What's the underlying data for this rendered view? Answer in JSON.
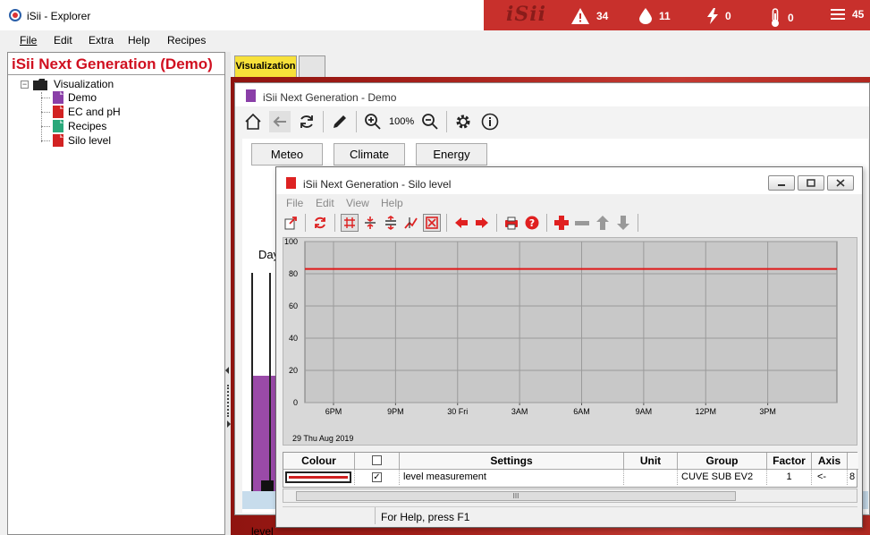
{
  "app": {
    "title": "iSii - Explorer"
  },
  "status_bar": {
    "logo": "iSii",
    "items": [
      {
        "icon": "warning-icon",
        "value": "34"
      },
      {
        "icon": "drop-icon",
        "value": "11"
      },
      {
        "icon": "lightning-icon",
        "value": "0"
      },
      {
        "icon": "thermometer-icon",
        "value": "0"
      },
      {
        "icon": "list-icon",
        "value": "45"
      }
    ],
    "color": "#c8302c"
  },
  "menu": {
    "file": "File",
    "edit": "Edit",
    "extra": "Extra",
    "help": "Help",
    "recipes": "Recipes"
  },
  "explorer": {
    "brand": "iSii Next Generation (Demo)",
    "root": "Visualization",
    "items": [
      {
        "label": "Demo",
        "color": "#8a3fa8"
      },
      {
        "label": "EC and pH",
        "color": "#d22222"
      },
      {
        "label": "Recipes",
        "color": "#2aa87a"
      },
      {
        "label": "Silo level",
        "color": "#d22222"
      }
    ]
  },
  "tabs": {
    "active": "Visualization",
    "second": ""
  },
  "demo_window": {
    "title": "iSii Next Generation - Demo",
    "zoom": "100%",
    "buttons": {
      "meteo": "Meteo",
      "climate": "Climate",
      "energy": "Energy"
    },
    "day_label": "Day",
    "level_label": "level",
    "silo_fill_fraction": 0.56
  },
  "silo_window": {
    "title": "iSii Next Generation - Silo level",
    "menu": {
      "file": "File",
      "edit": "Edit",
      "view": "View",
      "help": "Help"
    },
    "status_text": "For Help, press F1",
    "scroll_grip": "III",
    "table": {
      "headers": {
        "colour": "Colour",
        "settings": "Settings",
        "unit": "Unit",
        "group": "Group",
        "factor": "Factor",
        "axis": "Axis"
      },
      "row": {
        "settings": "level measurement",
        "unit": "",
        "group": "CUVE SUB EV2",
        "factor": "1",
        "axis": "<-",
        "extra": "8",
        "checked": "✓",
        "line_color": "#d02020"
      }
    }
  },
  "chart_data": {
    "type": "line",
    "x_ticks": [
      "6PM",
      "9PM",
      "30 Fri",
      "3AM",
      "6AM",
      "9AM",
      "12PM",
      "3PM"
    ],
    "x_start_label": "29 Thu Aug 2019",
    "y_ticks": [
      "0",
      "20",
      "40",
      "60",
      "80",
      "100"
    ],
    "ylim": [
      0,
      100
    ],
    "series": [
      {
        "color": "#e01818",
        "values": [
          83,
          83
        ]
      }
    ],
    "grid": true
  }
}
